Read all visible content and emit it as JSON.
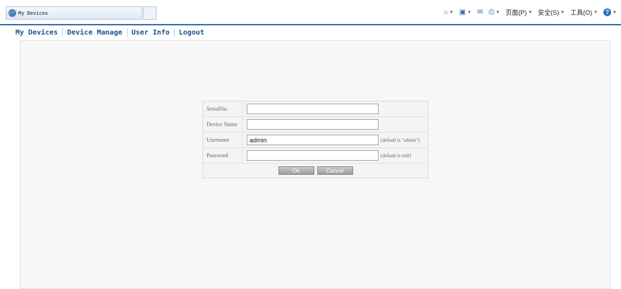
{
  "browser": {
    "tab_title": "My Devices",
    "toolbar": {
      "page_label": "页面(P)",
      "safety_label": "安全(S)",
      "tools_label": "工具(O)"
    }
  },
  "nav": {
    "items": [
      {
        "label": "My Devices"
      },
      {
        "label": "Device Manage"
      },
      {
        "label": "User Info"
      },
      {
        "label": "Logout"
      }
    ]
  },
  "form": {
    "serial": {
      "label": "SerialNo.",
      "value": ""
    },
    "device_name": {
      "label": "Device Name",
      "value": ""
    },
    "username": {
      "label": "Username",
      "value": "admin",
      "hint": "(default is \"admin\")"
    },
    "password": {
      "label": "Password",
      "value": "",
      "hint": "(default is null)"
    },
    "ok_label": "Ok",
    "cancel_label": "Cancel"
  },
  "colors": {
    "nav_link": "#1d4f8f",
    "accent_bar": "#3a6fb0",
    "panel_bg": "#f7f7f7"
  }
}
